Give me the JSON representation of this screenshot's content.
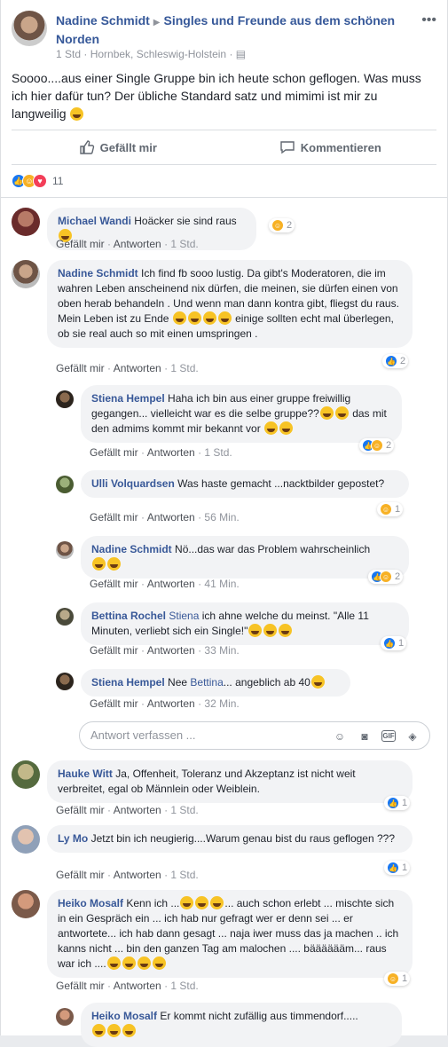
{
  "post": {
    "author": "Nadine Schmidt",
    "group": "Singles und Freunde aus dem schönen Norden",
    "time": "1 Std",
    "location": "Hornbek, Schleswig-Holstein",
    "text": "Soooo....aus einer Single Gruppe bin ich heute schon geflogen. Was muss ich hier dafür tun? Der übliche Standard satz und mimimi ist mir zu langweilig",
    "like_label": "Gefällt mir",
    "comment_label": "Kommentieren",
    "reaction_count": "11"
  },
  "comments": [
    {
      "name": "Michael Wandi",
      "text": "Hoäcker sie sind raus",
      "like": "Gefällt mir",
      "reply": "Antworten",
      "time": "1 Std.",
      "react": "2"
    },
    {
      "name": "Nadine Schmidt",
      "text": "Ich find fb sooo lustig. Da gibt's Moderatoren, die im wahren Leben anscheinend nix dürfen, die meinen, sie dürfen einen von oben herab behandeln . Und wenn man dann kontra gibt, fliegst du raus. Mein Leben ist zu Ende",
      "text2": "einige sollten echt mal überlegen, ob sie real auch so mit einen umspringen .",
      "like": "Gefällt mir",
      "reply": "Antworten",
      "time": "1 Std.",
      "react": "2"
    },
    {
      "name": "Stiena Hempel",
      "text": "Haha ich bin aus einer gruppe freiwillig gegangen... vielleicht war es die selbe gruppe??",
      "text2": "das mit den admims kommt mir bekannt vor",
      "like": "Gefällt mir",
      "reply": "Antworten",
      "time": "1 Std.",
      "react": "2"
    },
    {
      "name": "Ulli Volquardsen",
      "text": "Was haste gemacht ...nacktbilder gepostet?",
      "like": "Gefällt mir",
      "reply": "Antworten",
      "time": "56 Min.",
      "react": "1"
    },
    {
      "name": "Nadine Schmidt",
      "text": "Nö...das war das Problem wahrscheinlich",
      "like": "Gefällt mir",
      "reply": "Antworten",
      "time": "41 Min.",
      "react": "2"
    },
    {
      "name": "Bettina Rochel",
      "mention": "Stiena",
      "text": "ich ahne welche du meinst. \"Alle 11 Minuten, verliebt sich ein Single!\"",
      "like": "Gefällt mir",
      "reply": "Antworten",
      "time": "33 Min.",
      "react": "1"
    },
    {
      "name": "Stiena Hempel",
      "pre": "Nee",
      "mention": "Bettina",
      "text": "... angeblich ab 40",
      "like": "Gefällt mir",
      "reply": "Antworten",
      "time": "32 Min."
    },
    {
      "name": "Hauke Witt",
      "text": "Ja, Offenheit, Toleranz und Akzeptanz ist nicht weit verbreitet, egal ob Männlein oder Weiblein.",
      "like": "Gefällt mir",
      "reply": "Antworten",
      "time": "1 Std.",
      "react": "1"
    },
    {
      "name": "Ly Mo",
      "text": "Jetzt bin ich neugierig....Warum genau bist du raus geflogen ???",
      "like": "Gefällt mir",
      "reply": "Antworten",
      "time": "1 Std.",
      "react": "1"
    },
    {
      "name": "Heiko Mosalf",
      "text": "Kenn ich ...",
      "text2": "... auch schon erlebt ... mischte sich in ein Gespräch ein ... ich hab nur gefragt wer er denn sei ... er antwortete... ich hab dann gesagt ... naja iwer muss das ja machen .. ich kanns nicht ... bin den ganzen Tag am malochen .... bääääääm... raus war ich ....",
      "like": "Gefällt mir",
      "reply": "Antworten",
      "time": "1 Std.",
      "react": "1"
    },
    {
      "name": "Heiko Mosalf",
      "text": "Er kommt nicht zufällig aus timmendorf....."
    }
  ],
  "reply_box": {
    "placeholder": "Antwort verfassen ..."
  },
  "colors": {
    "link": "#385898",
    "accent": "#1877f2",
    "haha": "#f7b125",
    "love": "#f33e58"
  }
}
